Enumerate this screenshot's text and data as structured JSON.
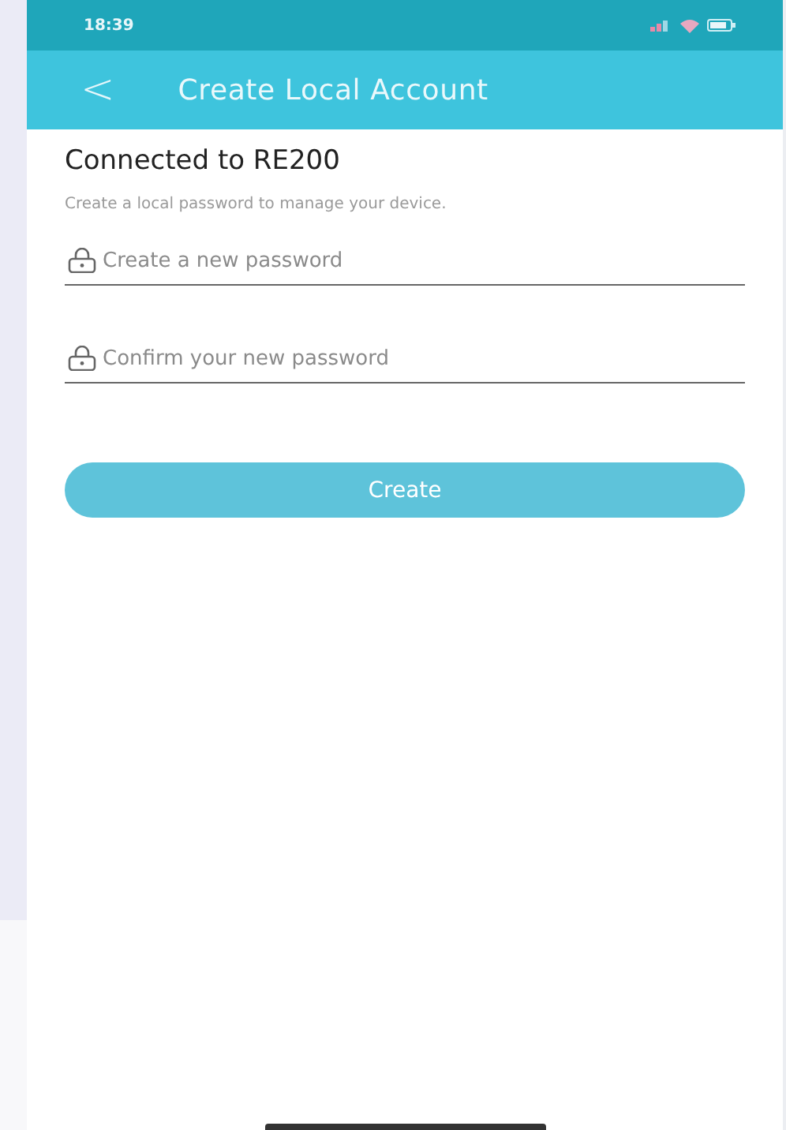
{
  "status_bar": {
    "time": "18:39"
  },
  "header": {
    "back": "<",
    "title": "Create Local Account"
  },
  "heading": "Connected to RE200",
  "subtitle": "Create a local password to manage your device.",
  "fields": [
    {
      "placeholder": "Create a new password"
    },
    {
      "placeholder": "Confirm your new password"
    }
  ],
  "button": {
    "label": "Create",
    "disabled": true
  }
}
